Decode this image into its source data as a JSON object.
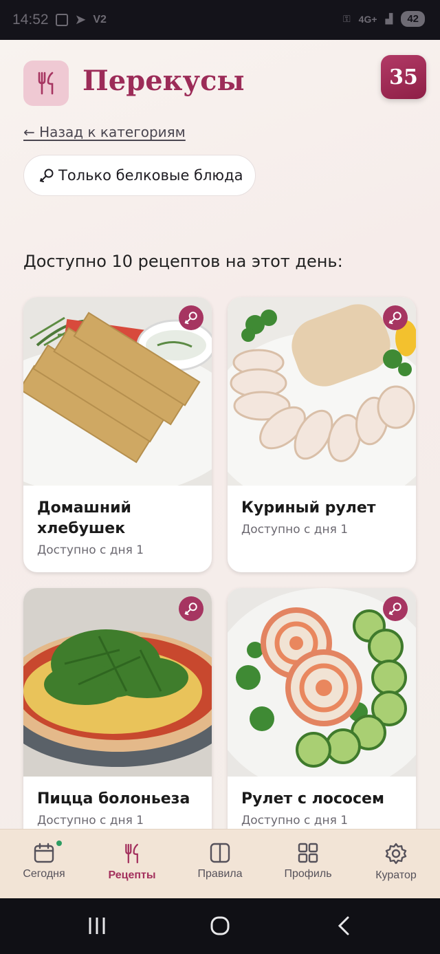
{
  "status_bar": {
    "time": "14:52",
    "carrier": "V2",
    "network": "4G+",
    "battery": "42"
  },
  "header": {
    "title": "Перекусы",
    "day_number": "35",
    "back_link": "← Назад к категориям",
    "filter_chip": "Только белковые блюда",
    "available_text": "Доступно 10 рецептов на этот день:"
  },
  "recipes": [
    {
      "title": "Домашний хлебушек",
      "subtitle": "Доступно с дня 1",
      "icon": "drumstick-icon"
    },
    {
      "title": "Куриный рулет",
      "subtitle": "Доступно с дня 1",
      "icon": "drumstick-icon"
    },
    {
      "title": "Пицца болоньеза",
      "subtitle": "Доступно с дня 1",
      "icon": "drumstick-icon"
    },
    {
      "title": "Рулет с лососем",
      "subtitle": "Доступно с дня 1",
      "icon": "drumstick-icon"
    }
  ],
  "bottom_nav": [
    {
      "label": "Сегодня",
      "icon": "calendar-icon",
      "active": false
    },
    {
      "label": "Рецепты",
      "icon": "cutlery-icon",
      "active": true
    },
    {
      "label": "Правила",
      "icon": "book-icon",
      "active": false
    },
    {
      "label": "Профиль",
      "icon": "grid-icon",
      "active": false
    },
    {
      "label": "Куратор",
      "icon": "gear-icon",
      "active": false
    }
  ],
  "colors": {
    "accent": "#a3305d",
    "badge": "#9c1f4b",
    "nav_background": "#f2e4d6",
    "page_background": "#f6efeb"
  }
}
